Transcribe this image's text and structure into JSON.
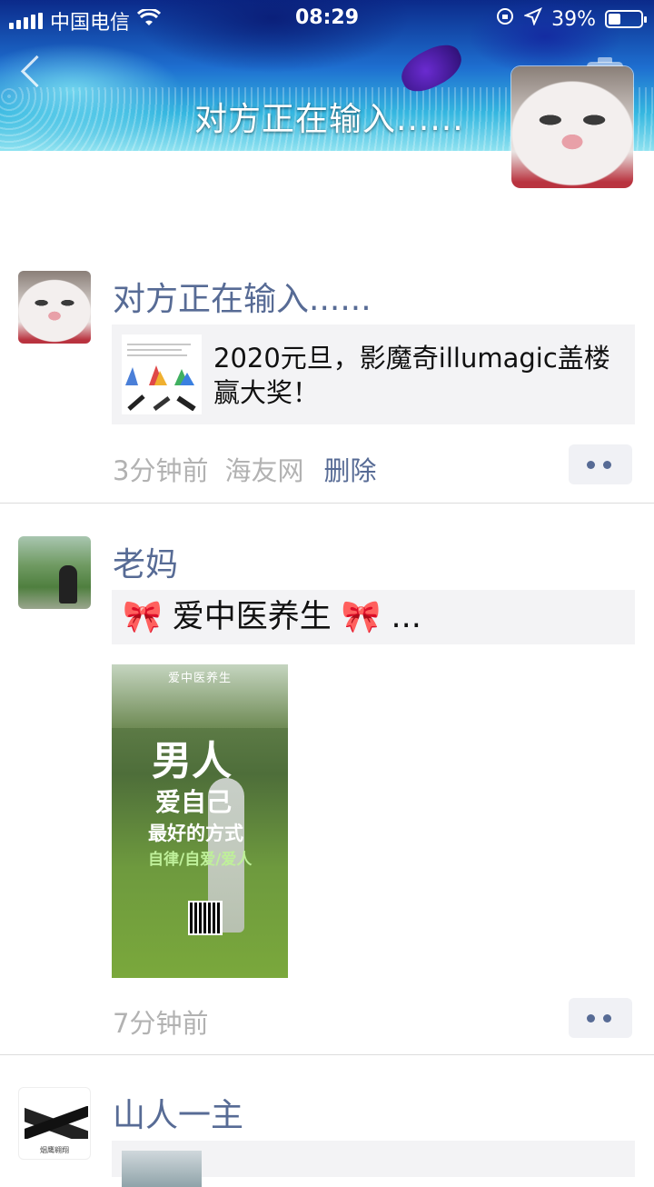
{
  "status_bar": {
    "carrier": "中国电信",
    "time": "08:29",
    "battery": "39%",
    "battery_level": 0.39
  },
  "header": {
    "title": "对方正在输入......"
  },
  "posts": [
    {
      "name": "对方正在输入......",
      "link_title": "2020元旦，影魔奇illumagic盖楼赢大奖！",
      "time": "3分钟前",
      "source": "海友网",
      "delete_label": "删除"
    },
    {
      "name": "老妈",
      "text": "🎀 爱中医养生 🎀 ...",
      "poster": {
        "header": "爱中医养生",
        "line1": "男人",
        "line2": "爱自己",
        "line3": "最好的方式",
        "line4": "自律/自爱/爱人"
      },
      "time": "7分钟前"
    },
    {
      "name": "山人一主",
      "avatar_caption": "烟鹰翱翔"
    }
  ]
}
